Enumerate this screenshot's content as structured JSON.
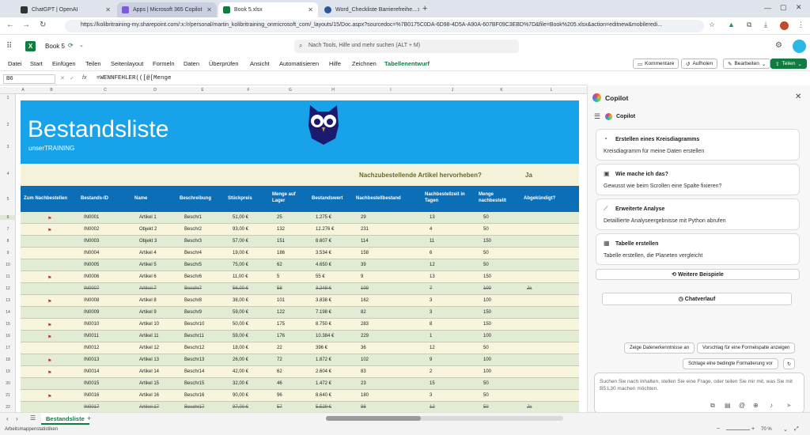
{
  "browser": {
    "tabs": [
      {
        "label": "ChatGPT | OpenAI",
        "color": "#333333"
      },
      {
        "label": "Apps | Microsoft 365 Copilot",
        "color": "#7b5cd6"
      },
      {
        "label": "Book 5.xlsx",
        "color": "#107c41"
      },
      {
        "label": "Word_Checkliste Barrierefreihe...",
        "color": "#2b579a"
      }
    ],
    "new_tab": "+",
    "url": "https://kolibritraining-my.sharepoint.com/:x:/r/personal/martin_kolibritraining_onmicrosoft_com/_layouts/15/Doc.aspx?sourcedoc=%7B0175C0DA-6D98-4D5A-A90A-607BF09C3EBD%7D&file=Book%205.xlsx&action=editnew&mobileredi..."
  },
  "excel": {
    "filename": "Book 5",
    "search_placeholder": "Nach Tools, Hilfe und mehr suchen (ALT + M)",
    "menu": [
      "Datei",
      "Start",
      "Einfügen",
      "Teilen",
      "Seitenlayout",
      "Formeln",
      "Daten",
      "Überprüfen",
      "Ansicht",
      "Automatisieren",
      "Hilfe",
      "Zeichnen",
      "Tabellenentwurf"
    ],
    "buttons": {
      "comments": "Kommentare",
      "catchup": "Aufholen",
      "edit": "Bearbeiten",
      "share": "Teilen"
    },
    "namebox": "B6",
    "fx": "fx",
    "formula": "=WENNFEHLER(([@[Menge"
  },
  "columns": [
    "A",
    "B",
    "C",
    "D",
    "E",
    "F",
    "G",
    "H",
    "I",
    "J",
    "K",
    "L"
  ],
  "rows": [
    "1",
    "2",
    "3",
    "4",
    "5",
    "6",
    "7",
    "8",
    "9",
    "10",
    "11",
    "12",
    "13",
    "14",
    "15",
    "16",
    "17",
    "18",
    "19",
    "20",
    "21",
    "22"
  ],
  "sheet": {
    "title": "Bestandsliste",
    "subtitle": "unserTRAINING",
    "highlight_label": "Nachzubestellende Artikel hervorheben?",
    "highlight_value": "Ja",
    "headers": [
      "Zum Nachbestellen",
      "Bestands-ID",
      "Name",
      "Beschreibung",
      "Stückpreis",
      "Menge auf Lager",
      "Bestandswert",
      "Nachbestellbestand",
      "Nachbestellzeit in Tagen",
      "Menge nachbestellt",
      "Abgekündigt?"
    ],
    "items": [
      {
        "flag": true,
        "id": "IN0001",
        "name": "Artikel 1",
        "desc": "Beschr1",
        "price": "51,00 €",
        "qty": "25",
        "value": "1.275 €",
        "reorder": "29",
        "days": "13",
        "ordered": "50",
        "disc": "",
        "strike": false
      },
      {
        "flag": true,
        "id": "IN0002",
        "name": "Objekt 2",
        "desc": "Beschr2",
        "price": "93,00 €",
        "qty": "132",
        "value": "12.276 €",
        "reorder": "231",
        "days": "4",
        "ordered": "50",
        "disc": "",
        "strike": false
      },
      {
        "flag": false,
        "id": "IN0003",
        "name": "Objekt 3",
        "desc": "Beschr3",
        "price": "57,00 €",
        "qty": "151",
        "value": "8.607 €",
        "reorder": "114",
        "days": "11",
        "ordered": "150",
        "disc": "",
        "strike": false
      },
      {
        "flag": false,
        "id": "IN0004",
        "name": "Artikel 4",
        "desc": "Beschr4",
        "price": "19,00 €",
        "qty": "186",
        "value": "3.534 €",
        "reorder": "158",
        "days": "6",
        "ordered": "50",
        "disc": "",
        "strike": false
      },
      {
        "flag": false,
        "id": "IN0005",
        "name": "Artikel 5",
        "desc": "Beschr5",
        "price": "75,00 €",
        "qty": "62",
        "value": "4.650 €",
        "reorder": "39",
        "days": "12",
        "ordered": "50",
        "disc": "",
        "strike": false
      },
      {
        "flag": true,
        "id": "IN0006",
        "name": "Artikel 6",
        "desc": "Beschr6",
        "price": "11,00 €",
        "qty": "5",
        "value": "55 €",
        "reorder": "9",
        "days": "13",
        "ordered": "150",
        "disc": "",
        "strike": false
      },
      {
        "flag": false,
        "id": "IN0007",
        "name": "Artikel 7",
        "desc": "Beschr7",
        "price": "56,00 €",
        "qty": "58",
        "value": "3.248 €",
        "reorder": "109",
        "days": "7",
        "ordered": "100",
        "disc": "Ja",
        "strike": true
      },
      {
        "flag": true,
        "id": "IN0008",
        "name": "Artikel 8",
        "desc": "Beschr8",
        "price": "38,00 €",
        "qty": "101",
        "value": "3.838 €",
        "reorder": "162",
        "days": "3",
        "ordered": "100",
        "disc": "",
        "strike": false
      },
      {
        "flag": false,
        "id": "IN0009",
        "name": "Artikel 9",
        "desc": "Beschr9",
        "price": "59,00 €",
        "qty": "122",
        "value": "7.198 €",
        "reorder": "82",
        "days": "3",
        "ordered": "150",
        "disc": "",
        "strike": false
      },
      {
        "flag": true,
        "id": "IN0010",
        "name": "Artikel 10",
        "desc": "Beschr10",
        "price": "50,00 €",
        "qty": "175",
        "value": "8.750 €",
        "reorder": "283",
        "days": "8",
        "ordered": "150",
        "disc": "",
        "strike": false
      },
      {
        "flag": true,
        "id": "IN0011",
        "name": "Artikel 11",
        "desc": "Beschr11",
        "price": "59,00 €",
        "qty": "176",
        "value": "10.384 €",
        "reorder": "229",
        "days": "1",
        "ordered": "100",
        "disc": "",
        "strike": false
      },
      {
        "flag": false,
        "id": "IN0012",
        "name": "Artikel 12",
        "desc": "Beschr12",
        "price": "18,00 €",
        "qty": "22",
        "value": "396 €",
        "reorder": "36",
        "days": "12",
        "ordered": "50",
        "disc": "",
        "strike": false
      },
      {
        "flag": true,
        "id": "IN0013",
        "name": "Artikel 13",
        "desc": "Beschr13",
        "price": "26,00 €",
        "qty": "72",
        "value": "1.872 €",
        "reorder": "102",
        "days": "9",
        "ordered": "100",
        "disc": "",
        "strike": false
      },
      {
        "flag": true,
        "id": "IN0014",
        "name": "Artikel 14",
        "desc": "Beschr14",
        "price": "42,00 €",
        "qty": "62",
        "value": "2.604 €",
        "reorder": "83",
        "days": "2",
        "ordered": "100",
        "disc": "",
        "strike": false
      },
      {
        "flag": false,
        "id": "IN0015",
        "name": "Artikel 15",
        "desc": "Beschr15",
        "price": "32,00 €",
        "qty": "46",
        "value": "1.472 €",
        "reorder": "23",
        "days": "15",
        "ordered": "50",
        "disc": "",
        "strike": false
      },
      {
        "flag": true,
        "id": "IN0016",
        "name": "Artikel 16",
        "desc": "Beschr16",
        "price": "90,00 €",
        "qty": "96",
        "value": "8.640 €",
        "reorder": "180",
        "days": "3",
        "ordered": "50",
        "disc": "",
        "strike": false
      },
      {
        "flag": false,
        "id": "IN0017",
        "name": "Artikel 17",
        "desc": "Beschr17",
        "price": "97,00 €",
        "qty": "57",
        "value": "5.529 €",
        "reorder": "98",
        "days": "12",
        "ordered": "50",
        "disc": "Ja",
        "strike": true
      }
    ]
  },
  "copilot": {
    "title": "Copilot",
    "subtitle": "Copilot",
    "cards": [
      {
        "title": "Erstellen eines Kreisdiagramms",
        "desc": "Kreisdiagramm für meine Daten erstellen",
        "icon": "pie-icon"
      },
      {
        "title": "Wie mache ich das?",
        "desc": "Gewusst wie beim Scrollen eine Spalte fixieren?",
        "icon": "help-icon"
      },
      {
        "title": "Erweiterte Analyse",
        "desc": "Detaillierte Analyseergebnisse mit Python abrufen",
        "icon": "chart-icon"
      },
      {
        "title": "Tabelle erstellen",
        "desc": "Tabelle erstellen, die Planeten vergleicht",
        "icon": "table-icon"
      }
    ],
    "more": "Weitere Beispiele",
    "history": "Chatverlauf",
    "suggestions": [
      "Zeige Datenerkenntnisse an",
      "Vorschlag für eine Formelspalte anzeigen",
      "Schlage eine bedingte Formatierung vor"
    ],
    "input_placeholder": "Suchen Sie nach Inhalten, stellen Sie eine Frage, oder teilen Sie mir mit, was Sie mit B5:L30 machen möchten."
  },
  "bottom": {
    "sheet_tab": "Bestandsliste",
    "add": "+",
    "status": "Arbeitsmappenstatistiken",
    "zoom": "70 %"
  }
}
